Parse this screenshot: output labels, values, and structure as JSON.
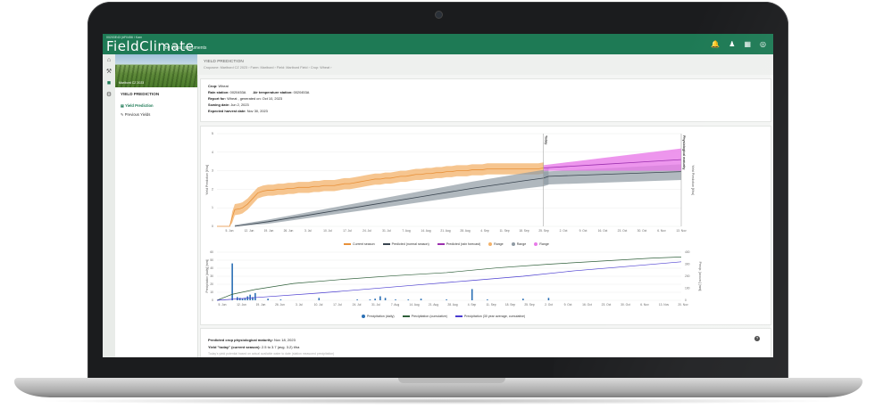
{
  "header": {
    "station_id": "00203E43 (#F0456 / Kam",
    "logo": "FieldClimate",
    "logo_sub": "by Pessl Instruments",
    "icons": [
      "bell-icon",
      "user-icon",
      "stations-icon",
      "signal-icon"
    ]
  },
  "sidebar": {
    "field_label": "Maribord CZ 2023",
    "section_title": "YIELD PREDICTION",
    "items": [
      {
        "label": "Yield Prediction",
        "active": true
      },
      {
        "label": "Previous Yields",
        "active": false
      }
    ]
  },
  "breadcrumb": {
    "title": "YIELD PREDICTION",
    "path": "Cropzone: Maribord CZ 2023 › Farm: Maribord › Field: Maribord Field › Crop: Wheat ›"
  },
  "info": {
    "crop_label": "Crop:",
    "crop_value": "Wheat",
    "rain_label": "Rain station:",
    "rain_value": "0020453A",
    "air_label": "Air temperature station:",
    "air_value": "0020453A",
    "report_label": "Report for:",
    "report_value": "Wheat , generated on: Oct 10, 2023",
    "sowing_label": "Sowing date:",
    "sowing_value": "Jun 2, 2023",
    "harvest_label": "Expected harvest date:",
    "harvest_value": "Nov 30, 2023"
  },
  "chart_data": [
    {
      "type": "line",
      "ylabel": "Yield Prediction [t/ha]",
      "ylabel_right": "Yield Prediction [t/ha]",
      "ylim": [
        0,
        5
      ],
      "y_ticks": [
        0,
        1,
        2,
        3,
        4,
        5
      ],
      "x_ticks": [
        "5. Jun",
        "12. Jun",
        "19. Jun",
        "26. Jun",
        "3. Jul",
        "10. Jul",
        "17. Jul",
        "24. Jul",
        "31. Jul",
        "7. Aug",
        "14. Aug",
        "21. Aug",
        "28. Aug",
        "4. Sep",
        "11. Sep",
        "18. Sep",
        "25. Sep",
        "2. Oct",
        "9. Oct",
        "16. Oct",
        "23. Oct",
        "30. Oct",
        "6. Nov",
        "13. Nov"
      ],
      "annotations": [
        "Today",
        "Physiological maturity"
      ],
      "series": [
        {
          "name": "Current season",
          "color": "#e8913a",
          "x": [
            0,
            5,
            6,
            7,
            9,
            10,
            12,
            14,
            16,
            18,
            20,
            22,
            24,
            26,
            28,
            30,
            32,
            34,
            36,
            38,
            40,
            42,
            44,
            46,
            48,
            50,
            52,
            54,
            56,
            58,
            60,
            62,
            64,
            66,
            68,
            70,
            72,
            74,
            76,
            78,
            80,
            82,
            84,
            86,
            88,
            90,
            92,
            94,
            96,
            98,
            100,
            102,
            104,
            106,
            108,
            110,
            112,
            114,
            116,
            118,
            120,
            122,
            124,
            126,
            128
          ],
          "y": [
            0,
            0,
            0.5,
            0.9,
            0.95,
            1.0,
            1.2,
            1.5,
            1.8,
            1.9,
            1.95,
            1.95,
            2.0,
            2.0,
            2.05,
            2.05,
            2.1,
            2.1,
            2.1,
            2.15,
            2.15,
            2.2,
            2.2,
            2.2,
            2.25,
            2.3,
            2.3,
            2.35,
            2.4,
            2.45,
            2.5,
            2.55,
            2.55,
            2.6,
            2.6,
            2.65,
            2.7,
            2.7,
            2.75,
            2.8,
            2.8,
            2.85,
            2.85,
            2.9,
            2.9,
            2.95,
            2.95,
            3.0,
            3.0,
            3.0,
            3.05,
            3.05,
            3.05,
            3.1,
            3.1,
            3.1,
            3.1,
            3.1,
            3.1,
            3.1,
            3.1,
            3.1,
            3.1,
            3.1,
            3.15
          ]
        },
        {
          "name": "Predicted (normal season)",
          "color": "#3a4550",
          "x": [
            7,
            20,
            40,
            60,
            80,
            100,
            120,
            128,
            130
          ],
          "y": [
            0,
            0.25,
            0.7,
            1.15,
            1.6,
            2.05,
            2.45,
            2.6,
            2.7
          ]
        },
        {
          "name": "Predicted (rain forecast)",
          "color": "#9b2fae",
          "x": [
            128,
            140,
            152,
            164,
            176,
            182
          ],
          "y": [
            3.15,
            3.25,
            3.35,
            3.45,
            3.55,
            3.6
          ]
        },
        {
          "name": "Range",
          "color": "#f3b26a",
          "band": true
        },
        {
          "name": "Range",
          "color": "#8f9aa3",
          "band": true
        },
        {
          "name": "Range",
          "color": "#e87be8",
          "band": true
        }
      ]
    },
    {
      "type": "bar",
      "ylabel": "Precipitation [daily] [mm]",
      "ylabel_right": "Precip. [accum.] [mm]",
      "ylim": [
        0,
        60
      ],
      "ylim_right": [
        0,
        400
      ],
      "y_ticks": [
        0,
        10,
        20,
        30,
        40,
        50,
        60
      ],
      "y_ticks_right": [
        0,
        100,
        200,
        300,
        400
      ],
      "x_ticks": [
        "5. Jun",
        "12. Jun",
        "19. Jun",
        "26. Jun",
        "3. Jul",
        "10. Jul",
        "17. Jul",
        "24. Jul",
        "31. Jul",
        "7. Aug",
        "14. Aug",
        "21. Aug",
        "28. Aug",
        "4. Sep",
        "11. Sep",
        "18. Sep",
        "25. Sep",
        "2. Oct",
        "9. Oct",
        "16. Oct",
        "23. Oct",
        "30. Oct",
        "6. Nov",
        "13. Nov",
        "20. Nov"
      ],
      "series": [
        {
          "name": "Precipitation (daily)",
          "color": "#2a6fb5",
          "x": [
            6,
            8,
            9,
            10,
            11,
            12,
            13,
            14,
            15,
            20,
            25,
            40,
            55,
            60,
            62,
            64,
            66,
            70,
            75,
            80,
            90,
            100,
            106,
            120,
            130
          ],
          "y": [
            46,
            4,
            3,
            2,
            3,
            5,
            7,
            4,
            9,
            2,
            1,
            3,
            1,
            1,
            2,
            5,
            3,
            1,
            1,
            2,
            1,
            14,
            1,
            2,
            3
          ]
        },
        {
          "name": "Precipitation (cumulative)",
          "color": "#2f5f3a",
          "x": [
            0,
            6,
            15,
            30,
            50,
            70,
            90,
            110,
            130,
            150,
            170,
            182
          ],
          "y": [
            0,
            50,
            90,
            140,
            175,
            205,
            230,
            270,
            300,
            325,
            350,
            360
          ]
        },
        {
          "name": "Precipitation (30 year average, cumulative)",
          "color": "#4a3cd0",
          "x": [
            0,
            20,
            40,
            60,
            80,
            100,
            120,
            140,
            160,
            182
          ],
          "y": [
            0,
            30,
            60,
            95,
            130,
            165,
            200,
            245,
            280,
            320
          ]
        }
      ]
    }
  ],
  "summary": {
    "maturity_label": "Predicted crop physiological maturity:",
    "maturity_value": "Nov 18, 2023",
    "today_label": "Yield \"today\" (current season):",
    "today_value": "2.5 to 3.7 (avg. 3.2) t/ha",
    "note": "Today's yield potential based on actual available water to date (station measured precipitation)"
  }
}
